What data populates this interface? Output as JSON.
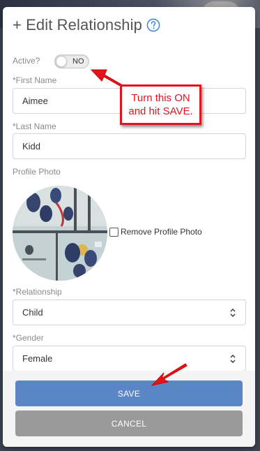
{
  "modal": {
    "title": "+ Edit Relationship",
    "help_icon": "help-circle-icon"
  },
  "active": {
    "label": "Active?",
    "value_text": "NO",
    "state": "off"
  },
  "first_name": {
    "label": "*First Name",
    "value": "Aimee"
  },
  "last_name": {
    "label": "*Last Name",
    "value": "Kidd"
  },
  "profile_photo": {
    "label": "Profile Photo",
    "remove_label": "Remove Profile Photo",
    "remove_checked": false
  },
  "relationship": {
    "label": "*Relationship",
    "value": "Child",
    "icon": "chevron-updown-icon"
  },
  "gender": {
    "label": "*Gender",
    "value": "Female",
    "icon": "chevron-updown-icon"
  },
  "footer": {
    "save_label": "SAVE",
    "cancel_label": "CANCEL"
  },
  "annotation": {
    "line1": "Turn this ON",
    "line2": "and hit SAVE.",
    "color": "#e4141b"
  },
  "colors": {
    "save_button": "#5b86c5",
    "cancel_button": "#9a9a9a",
    "help_icon": "#3d8fd6"
  }
}
